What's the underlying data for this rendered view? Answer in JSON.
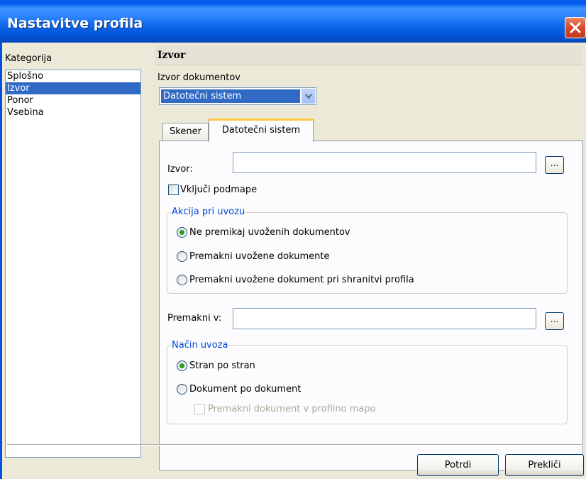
{
  "window": {
    "title": "Nastavitve profila"
  },
  "category": {
    "label": "Kategorija",
    "items": [
      {
        "label": "Splošno",
        "selected": false
      },
      {
        "label": "Izvor",
        "selected": true
      },
      {
        "label": "Ponor",
        "selected": false
      },
      {
        "label": "Vsebina",
        "selected": false
      }
    ]
  },
  "section": {
    "title": "Izvor"
  },
  "source_doc": {
    "label": "Izvor dokumentov",
    "value": "Datotečni sistem"
  },
  "tabs": [
    {
      "label": "Skener",
      "active": false
    },
    {
      "label": "Datotečni sistem",
      "active": true
    }
  ],
  "form": {
    "source_label": "Izvor:",
    "source_value": "",
    "browse_label": "...",
    "include_subfolders": {
      "label": "Vključi podmape",
      "checked": false
    },
    "import_action": {
      "title": "Akcija pri uvozu",
      "options": [
        {
          "label": "Ne premikaj uvoženih dokumentov",
          "checked": true
        },
        {
          "label": "Premakni uvožene dokumente",
          "checked": false
        },
        {
          "label": "Premakni uvožene dokument pri shranitvi profila",
          "checked": false
        }
      ]
    },
    "move_to_label": "Premakni v:",
    "move_to_value": "",
    "import_mode": {
      "title": "Način uvoza",
      "options": [
        {
          "label": "Stran po stran",
          "checked": true
        },
        {
          "label": "Dokument po dokument",
          "checked": false
        }
      ],
      "move_to_profile_folder": {
        "label": "Premakni dokument v profilno mapo",
        "checked": false,
        "enabled": false
      }
    }
  },
  "buttons": {
    "confirm": "Potrdi",
    "cancel": "Prekliči"
  },
  "colors": {
    "title_bar": "#0058ee",
    "selection": "#316ac5",
    "group_title": "#0046d5",
    "radio_dot": "#21a121",
    "tab_highlight": "#ffc83c"
  }
}
